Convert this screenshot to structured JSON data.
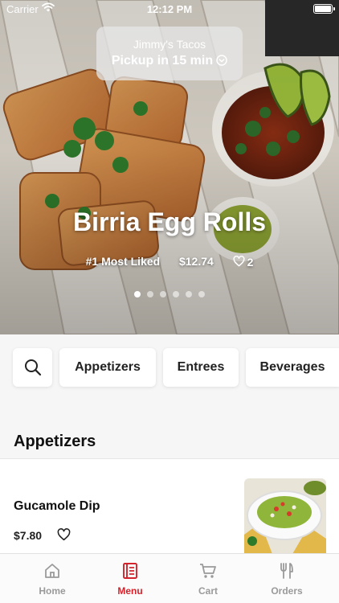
{
  "status_bar": {
    "carrier": "Carrier",
    "time": "12:12 PM"
  },
  "store": {
    "name": "Jimmy's Tacos",
    "pickup": "Pickup in 15 min"
  },
  "featured": {
    "title": "Birria Egg Rolls",
    "tag": "#1 Most Liked",
    "price": "$12.74",
    "likes": "2",
    "carousel_total": 6,
    "carousel_active": 1
  },
  "categories": [
    "Appetizers",
    "Entrees",
    "Beverages"
  ],
  "section": {
    "title": "Appetizers"
  },
  "items": [
    {
      "name": "Gucamole Dip",
      "price": "$7.80"
    }
  ],
  "tabs": [
    {
      "label": "Home",
      "icon": "home-icon"
    },
    {
      "label": "Menu",
      "icon": "menu-icon",
      "active": true
    },
    {
      "label": "Cart",
      "icon": "cart-icon"
    },
    {
      "label": "Orders",
      "icon": "orders-icon"
    }
  ],
  "colors": {
    "accent": "#d4232c",
    "inactive": "#9a9a9a"
  }
}
